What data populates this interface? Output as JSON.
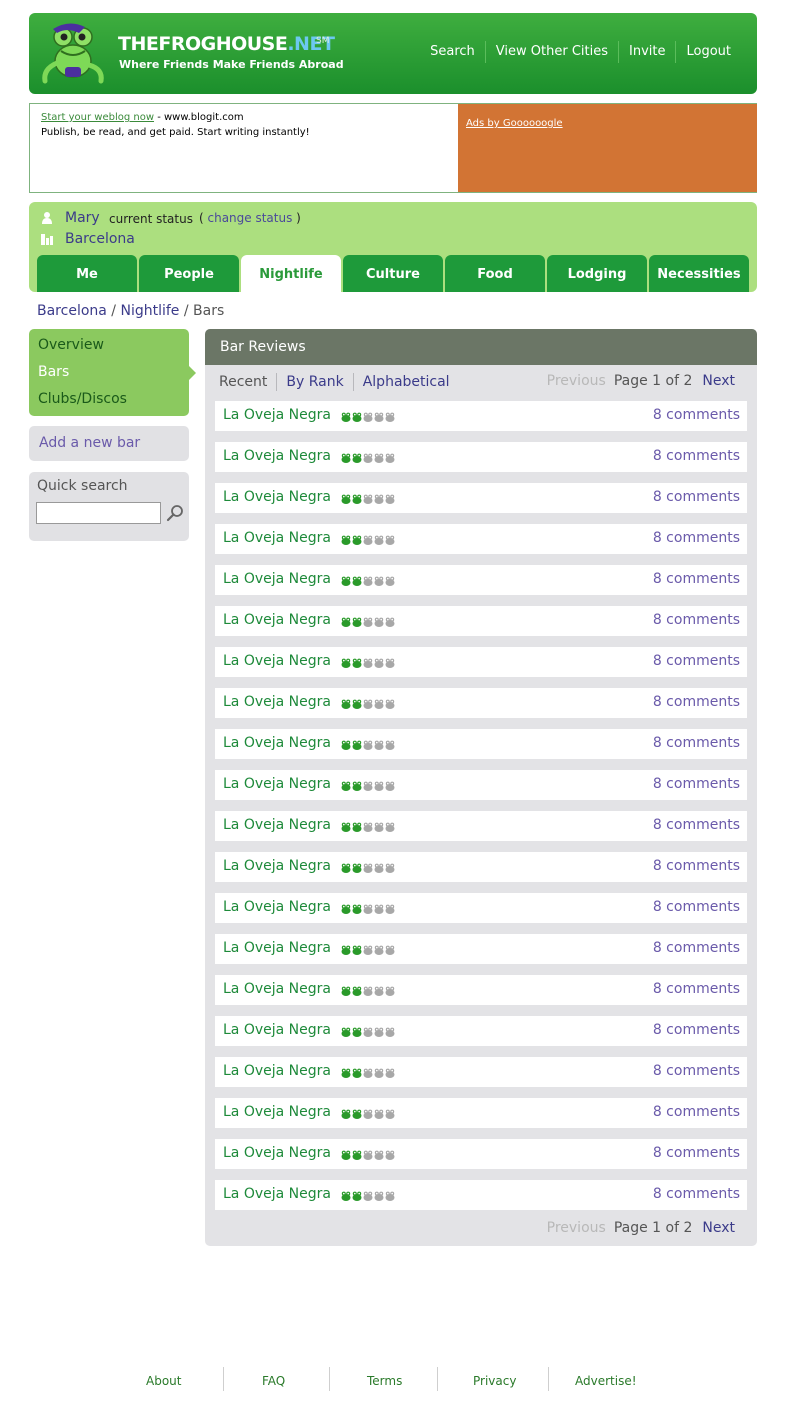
{
  "header": {
    "logo_name": "THEFROGHOUSE",
    "logo_net": ".NET",
    "logo_sm": "SM",
    "tagline": "Where Friends Make Friends Abroad",
    "nav": [
      "Search",
      "View Other Cities",
      "Invite",
      "Logout"
    ]
  },
  "ad": {
    "link_text": "Start your weblog now",
    "site": " - www.blogit.com",
    "body": "Publish, be read, and get paid. Start writing instantly!",
    "google": "Ads by Goooooogle",
    "colors": {
      "ad_panel": "#d27434"
    }
  },
  "user": {
    "name": "Mary",
    "status_label": "current status",
    "change_open": "( ",
    "change_link": "change status",
    "change_close": " )",
    "city": "Barcelona",
    "user_icon": "person-icon",
    "city_icon": "buildings-icon"
  },
  "tabs": [
    {
      "label": "Me",
      "active": false
    },
    {
      "label": "People",
      "active": false
    },
    {
      "label": "Nightlife",
      "active": true
    },
    {
      "label": "Culture",
      "active": false
    },
    {
      "label": "Food",
      "active": false
    },
    {
      "label": "Lodging",
      "active": false
    },
    {
      "label": "Necessities",
      "active": false
    }
  ],
  "breadcrumb": {
    "city": "Barcelona",
    "sep1": " / ",
    "section": "Nightlife",
    "sep2": " / ",
    "current": "Bars"
  },
  "sidebar": {
    "items": [
      "Overview",
      "Bars",
      "Clubs/Discos"
    ],
    "current_index": 1,
    "add_link": "Add a new bar",
    "search_label": "Quick search",
    "search_value": "",
    "search_icon": "magnifier-icon"
  },
  "panel": {
    "title": "Bar Reviews",
    "sort": [
      {
        "label": "Recent",
        "current": true
      },
      {
        "label": "By Rank",
        "current": false
      },
      {
        "label": "Alphabetical",
        "current": false
      }
    ],
    "pager": {
      "prev": "Previous",
      "pages": "Page 1 of 2",
      "next": "Next"
    },
    "rating_max": 5,
    "rows": [
      {
        "name": "La Oveja Negra",
        "rating": 2,
        "comments": "8 comments"
      },
      {
        "name": "La Oveja Negra",
        "rating": 2,
        "comments": "8 comments"
      },
      {
        "name": "La Oveja Negra",
        "rating": 2,
        "comments": "8 comments"
      },
      {
        "name": "La Oveja Negra",
        "rating": 2,
        "comments": "8 comments"
      },
      {
        "name": "La Oveja Negra",
        "rating": 2,
        "comments": "8 comments"
      },
      {
        "name": "La Oveja Negra",
        "rating": 2,
        "comments": "8 comments"
      },
      {
        "name": "La Oveja Negra",
        "rating": 2,
        "comments": "8 comments"
      },
      {
        "name": "La Oveja Negra",
        "rating": 2,
        "comments": "8 comments"
      },
      {
        "name": "La Oveja Negra",
        "rating": 2,
        "comments": "8 comments"
      },
      {
        "name": "La Oveja Negra",
        "rating": 2,
        "comments": "8 comments"
      },
      {
        "name": "La Oveja Negra",
        "rating": 2,
        "comments": "8 comments"
      },
      {
        "name": "La Oveja Negra",
        "rating": 2,
        "comments": "8 comments"
      },
      {
        "name": "La Oveja Negra",
        "rating": 2,
        "comments": "8 comments"
      },
      {
        "name": "La Oveja Negra",
        "rating": 2,
        "comments": "8 comments"
      },
      {
        "name": "La Oveja Negra",
        "rating": 2,
        "comments": "8 comments"
      },
      {
        "name": "La Oveja Negra",
        "rating": 2,
        "comments": "8 comments"
      },
      {
        "name": "La Oveja Negra",
        "rating": 2,
        "comments": "8 comments"
      },
      {
        "name": "La Oveja Negra",
        "rating": 2,
        "comments": "8 comments"
      },
      {
        "name": "La Oveja Negra",
        "rating": 2,
        "comments": "8 comments"
      },
      {
        "name": "La Oveja Negra",
        "rating": 2,
        "comments": "8 comments"
      }
    ]
  },
  "footer": {
    "links": [
      "About",
      "FAQ",
      "Terms",
      "Privacy",
      "Advertise!"
    ]
  },
  "colors": {
    "brand_green": "#1b8f2c",
    "light_green": "#acdf7f",
    "link_purple": "#3b3b8a",
    "frog_on": "#2a9a2a",
    "frog_off": "#a8a8a8"
  }
}
